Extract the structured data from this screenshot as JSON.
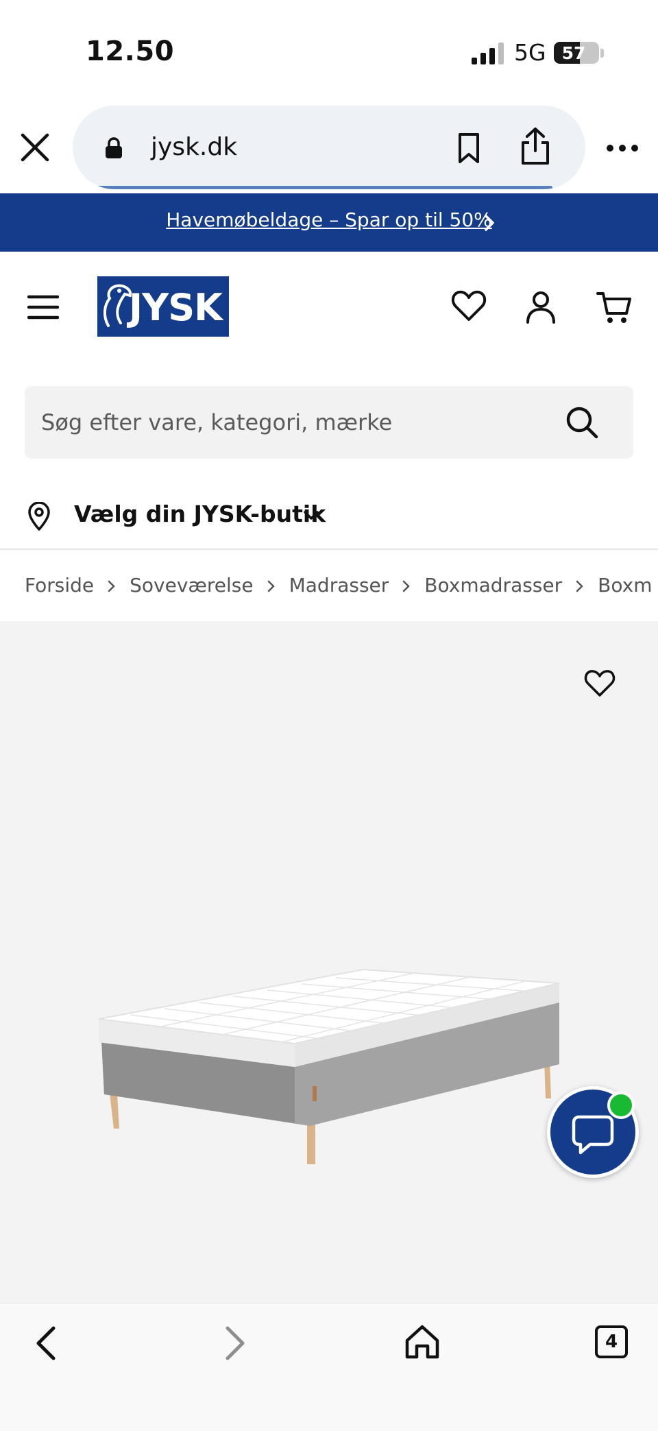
{
  "status_bar": {
    "time": "12.50",
    "network": "5G",
    "battery_percent": "57"
  },
  "browser": {
    "url": "jysk.dk",
    "tab_count": "4"
  },
  "promo": {
    "text": "Havemøbeldage – Spar op til 50%"
  },
  "header": {
    "logo_text": "JYSK"
  },
  "search": {
    "placeholder": "Søg efter vare, kategori, mærke"
  },
  "store": {
    "label": "Vælg din JYSK-butik"
  },
  "breadcrumb": [
    "Forside",
    "Soveværelse",
    "Madrasser",
    "Boxmadrasser",
    "Boxm"
  ],
  "colors": {
    "brand_blue": "#143c8a",
    "online_green": "#19b934"
  }
}
